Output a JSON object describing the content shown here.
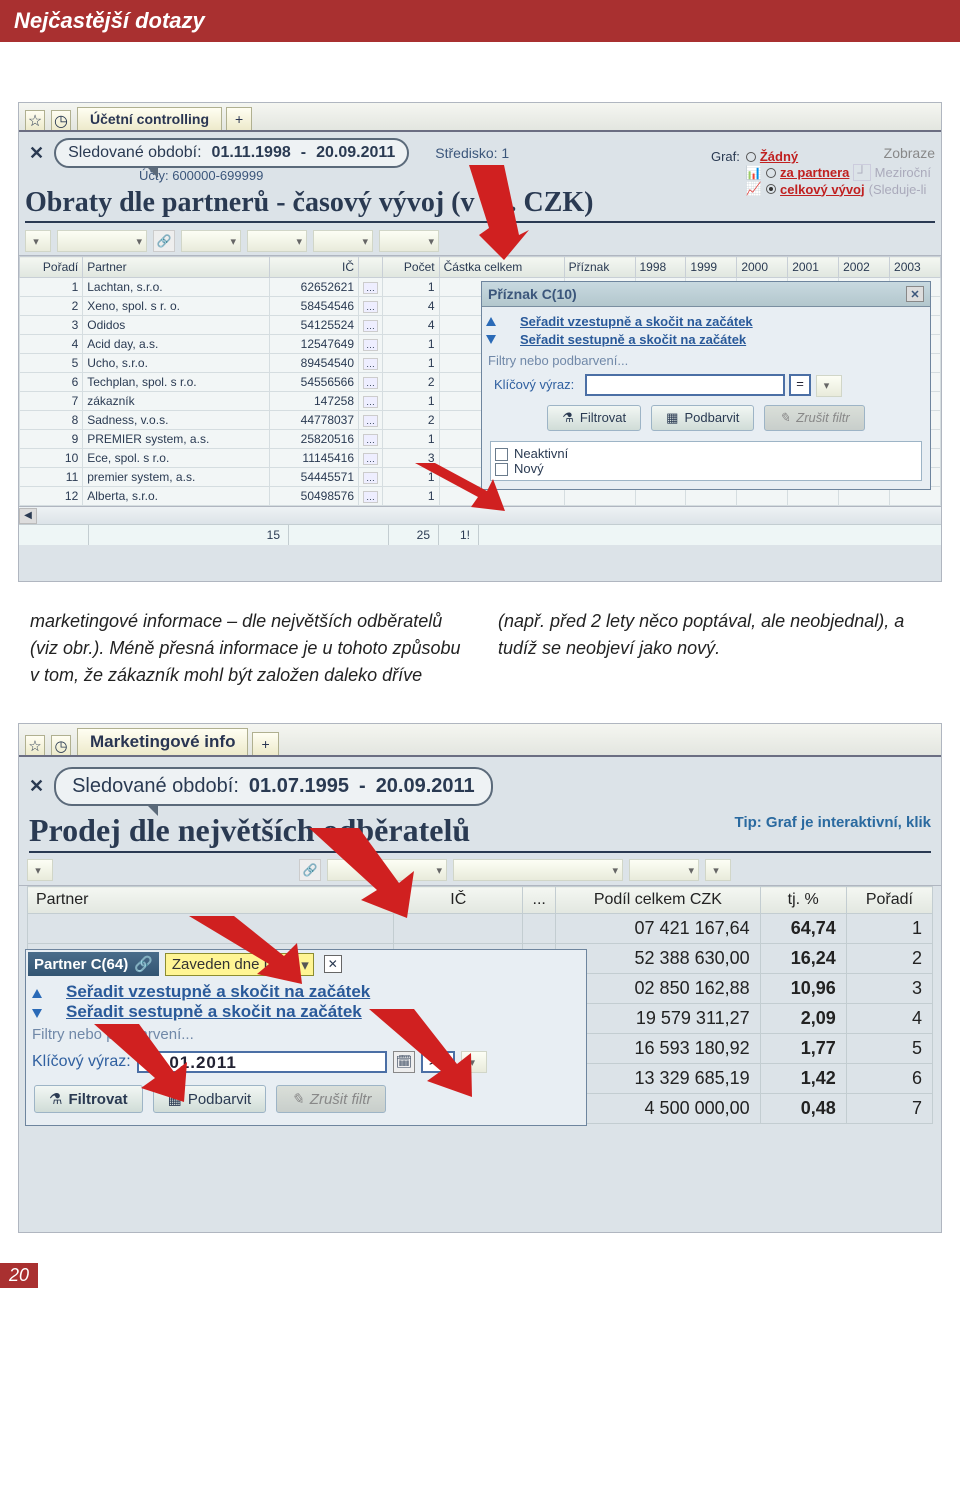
{
  "header": {
    "title": "Nejčastější dotazy"
  },
  "page_number": "20",
  "screenshot1": {
    "tab_label": "Účetní controlling",
    "period_label": "Sledované období:",
    "date_from": "01.11.1998",
    "date_sep": "-",
    "date_to": "20.09.2011",
    "stredisko": "Středisko: 1",
    "zobraze": "Zobraze",
    "ucty": "Účty: 600000-699999",
    "title": "Obraty dle partnerů - časový vývoj (v tis. CZK)",
    "graf_label": "Graf:",
    "radio_none": "Žádný",
    "radio_partner": "za partnera",
    "radio_total": "celkový vývoj",
    "mezir": "Meziroční",
    "sleduje": "(Sleduje-li",
    "columns": [
      "Pořadí",
      "Partner",
      "IČ",
      "",
      "Počet",
      "Částka celkem",
      "Příznak",
      "1998",
      "1999",
      "2000",
      "2001",
      "2002",
      "2003"
    ],
    "rows": [
      {
        "poradi": "1",
        "partner": "Lachtan, s.r.o.",
        "ic": "62652621",
        "pocet": "1"
      },
      {
        "poradi": "2",
        "partner": "Xeno, spol. s r. o.",
        "ic": "58454546",
        "pocet": "4"
      },
      {
        "poradi": "3",
        "partner": "Odidos",
        "ic": "54125524",
        "pocet": "4"
      },
      {
        "poradi": "4",
        "partner": "Acid day, a.s.",
        "ic": "12547649",
        "pocet": "1"
      },
      {
        "poradi": "5",
        "partner": "Ucho, s.r.o.",
        "ic": "89454540",
        "pocet": "1"
      },
      {
        "poradi": "6",
        "partner": "Techplan, spol. s r.o.",
        "ic": "54556566",
        "pocet": "2"
      },
      {
        "poradi": "7",
        "partner": "zákazník",
        "ic": "147258",
        "pocet": "1"
      },
      {
        "poradi": "8",
        "partner": "Sadness, v.o.s.",
        "ic": "44778037",
        "pocet": "2"
      },
      {
        "poradi": "9",
        "partner": "PREMIER system, a.s.",
        "ic": "25820516",
        "pocet": "1"
      },
      {
        "poradi": "10",
        "partner": "Ece, spol. s r.o.",
        "ic": "11145416",
        "pocet": "3"
      },
      {
        "poradi": "11",
        "partner": "premier system, a.s.",
        "ic": "54445571",
        "pocet": "1"
      },
      {
        "poradi": "12",
        "partner": "Alberta, s.r.o.",
        "ic": "50498576",
        "pocet": "1"
      }
    ],
    "footer": {
      "a": "15",
      "b": "25",
      "c": "1!"
    },
    "popup": {
      "title": "Příznak C(10)",
      "sort_asc": "Seřadit vzestupně a skočit na začátek",
      "sort_desc": "Seřadit sestupně a skočit na začátek",
      "filters_lbl": "Filtry nebo podbarvení...",
      "key_expr": "Klíčový výraz:",
      "eq": "=",
      "btn_filter": "Filtrovat",
      "btn_color": "Podbarvit",
      "btn_cancel": "Zrušit filtr",
      "chk1": "Neaktivní",
      "chk2": "Nový"
    }
  },
  "article": {
    "left": "marketingové informace – dle největších odběratelů (viz obr.). Méně přesná informace je u tohoto způsobu v tom, že zákazník mohl být založen daleko dříve",
    "right": "(např. před 2 lety něco poptával, ale neobjednal), a tudíž se neobjeví jako nový."
  },
  "screenshot2": {
    "tab_label": "Marketingové info",
    "period_label": "Sledované období:",
    "date_from": "01.07.1995",
    "date_sep": "-",
    "date_to": "20.09.2011",
    "tip": "Tip: Graf je interaktivní, klik",
    "title": "Prodej dle největších odběratelů",
    "columns": [
      "Partner",
      "IČ",
      "...",
      "Podíl celkem CZK",
      "tj. %",
      "Pořadí"
    ],
    "partner_hdr": "Partner C(64)",
    "zaveden": "Zaveden dne  D(8)",
    "sort_asc": "Seřadit vzestupně a skočit na začátek",
    "sort_desc": "Seřadit sestupně a skočit na začátek",
    "filters_lbl": "Filtry nebo podbarvení...",
    "key_expr": "Klíčový výraz:",
    "key_val": "01.01.2011",
    "op": ">=",
    "btn_filter": "Filtrovat",
    "btn_color": "Podbarvit",
    "btn_cancel": "Zrušit filtr",
    "rows": [
      {
        "podil": "07 421 167,64",
        "pct": "64,74",
        "poradi": "1"
      },
      {
        "podil": "52 388 630,00",
        "pct": "16,24",
        "poradi": "2"
      },
      {
        "podil": "02 850 162,88",
        "pct": "10,96",
        "poradi": "3"
      },
      {
        "podil": "19 579 311,27",
        "pct": "2,09",
        "poradi": "4"
      },
      {
        "podil": "16 593 180,92",
        "pct": "1,77",
        "poradi": "5"
      },
      {
        "podil": "13 329 685,19",
        "pct": "1,42",
        "poradi": "6"
      },
      {
        "podil": "4 500 000,00",
        "pct": "0,48",
        "poradi": "7"
      }
    ]
  }
}
